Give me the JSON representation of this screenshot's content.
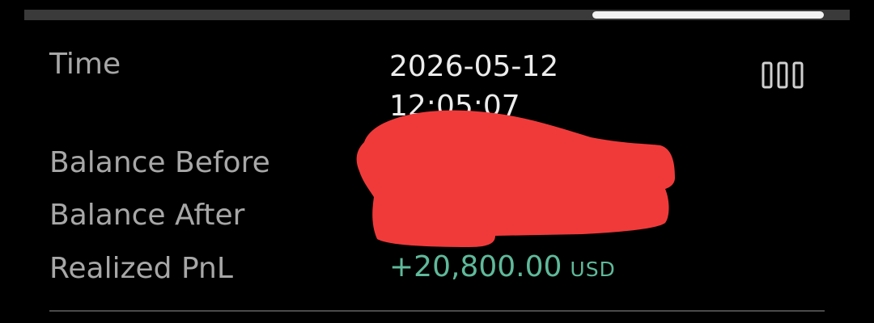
{
  "scrollbar": {
    "label": "horizontal-scrollbar",
    "position": 0.69
  },
  "detail": {
    "time_label": "Time",
    "time_date": "2026-05-12",
    "time_clock": "12:05:07",
    "balance_before_label": "Balance Before",
    "balance_after_label": "Balance After",
    "realized_pnl_label": "Realized PnL",
    "realized_pnl_value": "+20,800.00",
    "realized_pnl_currency": "USD"
  },
  "icons": {
    "menu": "grid-icon"
  },
  "colors": {
    "background": "#000000",
    "label_text": "#a7a7a7",
    "value_text": "#ececec",
    "profit_green": "#5fb99a",
    "redaction_red": "#f03a3a",
    "scroll_track": "#3a3a3a",
    "scroll_thumb": "#f2f2f2"
  }
}
